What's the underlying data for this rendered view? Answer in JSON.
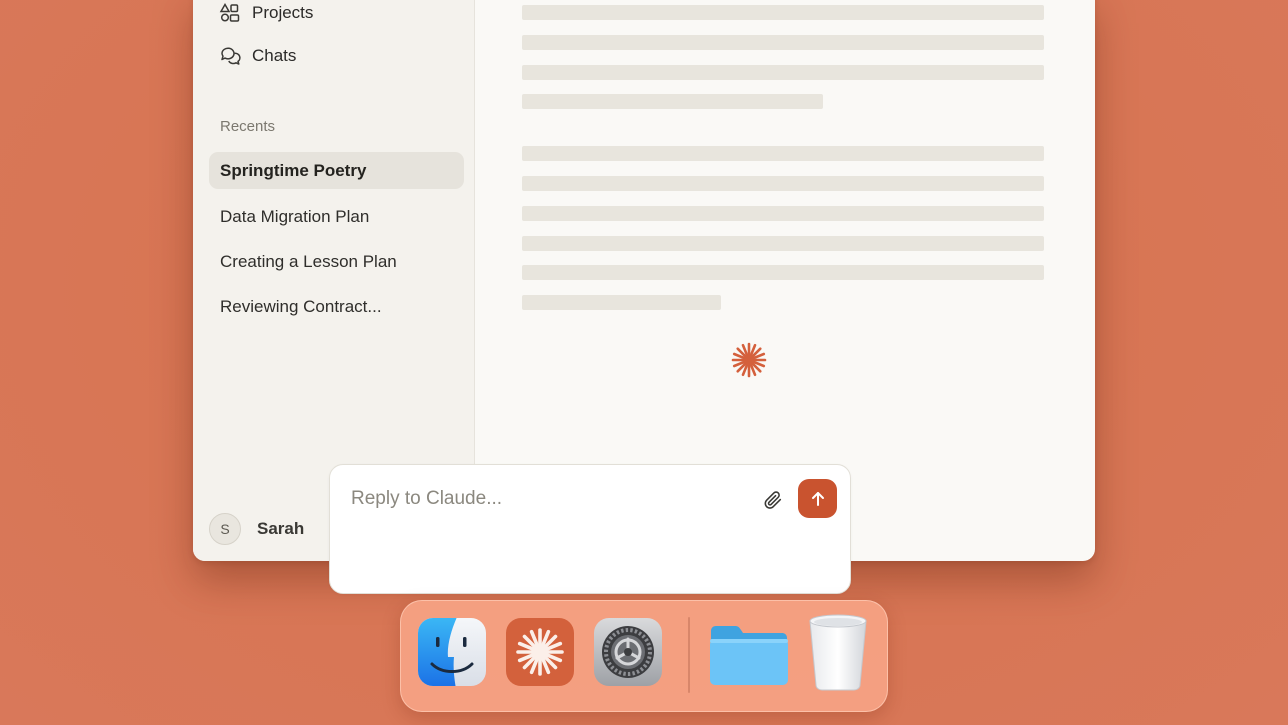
{
  "sidebar": {
    "nav": [
      {
        "label": "Projects",
        "icon": "projects-icon"
      },
      {
        "label": "Chats",
        "icon": "chats-icon"
      }
    ],
    "recents_label": "Recents",
    "recents": [
      {
        "label": "Springtime Poetry",
        "active": true
      },
      {
        "label": "Data Migration Plan",
        "active": false
      },
      {
        "label": "Creating a Lesson Plan",
        "active": false
      },
      {
        "label": "Reviewing Contract...",
        "active": false
      }
    ],
    "user": {
      "initial": "S",
      "name": "Sarah"
    }
  },
  "composer": {
    "placeholder": "Reply to Claude...",
    "attach_icon": "paperclip-icon",
    "send_icon": "arrow-up-icon"
  },
  "dock": {
    "apps": [
      "finder-icon",
      "claude-icon",
      "system-settings-icon",
      "folder-icon",
      "trash-icon"
    ]
  },
  "colors": {
    "background": "#d87655",
    "accent": "#c9532f",
    "sidebar": "#f4f2ed",
    "main": "#faf9f6",
    "active_item": "#e6e3dc"
  }
}
